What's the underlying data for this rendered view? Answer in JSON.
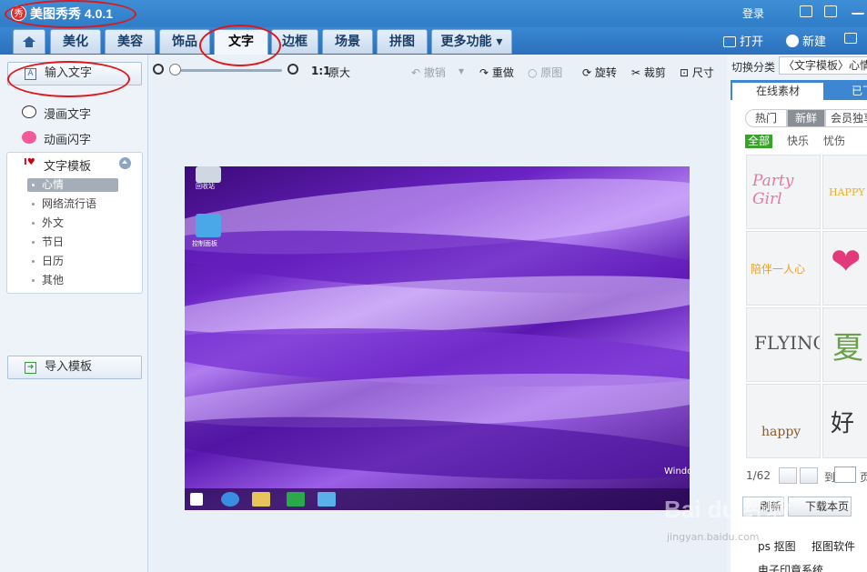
{
  "app": {
    "logo_text": "秀",
    "title": "美图秀秀 4.0.1",
    "login": "登录"
  },
  "tabs": [
    {
      "label": ""
    },
    {
      "label": "美化"
    },
    {
      "label": "美容"
    },
    {
      "label": "饰品"
    },
    {
      "label": "文字"
    },
    {
      "label": "边框"
    },
    {
      "label": "场景"
    },
    {
      "label": "拼图"
    },
    {
      "label": "更多功能 ▾"
    }
  ],
  "toolbar_right": {
    "open": "打开",
    "new": "新建"
  },
  "left_panel": {
    "input_text": "输入文字",
    "comic_text": "漫画文字",
    "animated_text": "动画闪字",
    "template_header": "文字模板",
    "template_items": [
      "心情",
      "网络流行语",
      "外文",
      "节日",
      "日历",
      "其他"
    ],
    "import_template": "导入模板"
  },
  "canvas_toolbar": {
    "zoom_ratio": "1:1",
    "original_size": "原大",
    "undo": "撤销",
    "redo": "重做",
    "original": "原图",
    "rotate": "旋转",
    "crop": "裁剪",
    "size": "尺寸"
  },
  "canvas": {
    "desktop_icon_label": "控制面板",
    "recycle_label": "回收站",
    "windows_text": "Windo"
  },
  "right_panel": {
    "switch_label": "切换分类",
    "switch_value": "〈文字模板〉心情",
    "tab_online": "在线素材",
    "tab_downloaded": "已下",
    "segments": [
      "热门",
      "新鲜",
      "会员独享"
    ],
    "categories": [
      "全部",
      "快乐",
      "忧伤"
    ],
    "thumbs": [
      "Party Girl",
      "HAPPY",
      "陪伴一人心",
      "❤",
      "FLYING",
      "夏",
      "happy",
      "好"
    ],
    "page": "1/62",
    "goto": "到",
    "page_suffix": "页",
    "refresh": "刷新",
    "download_page": "下载本页",
    "link1": "ps 抠图",
    "link2": "抠图软件",
    "link3": "电子印章系统"
  },
  "watermark": {
    "main": "Bai du 经验",
    "sub": "jingyan.baidu.com"
  }
}
